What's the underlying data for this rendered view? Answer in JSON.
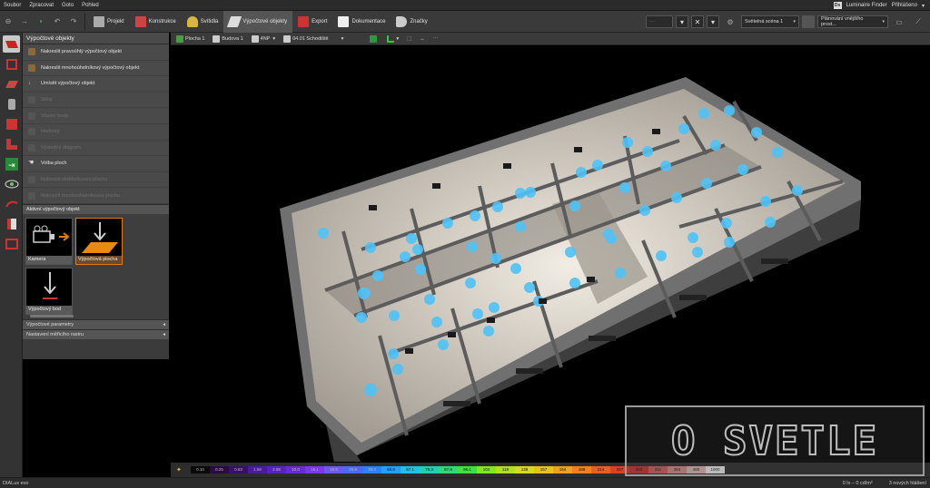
{
  "menu": {
    "items": [
      "Soubor",
      "Zpracovat",
      "Goto",
      "Pohled"
    ],
    "luminaire_finder": "Luminaire Finder",
    "login": "Přihlášeno"
  },
  "toolbar": {
    "tabs": [
      {
        "label": "Projekt",
        "color": "#b0b0b0"
      },
      {
        "label": "Konstrukce",
        "color": "#d9534f"
      },
      {
        "label": "Svítidla",
        "color": "#e8c14a"
      },
      {
        "label": "Výpočtové objekty",
        "color": "#cccccc",
        "active": true
      },
      {
        "label": "Export",
        "color": "#cc3333"
      },
      {
        "label": "Dokumentace",
        "color": "#ffffff"
      },
      {
        "label": "Značky",
        "color": "#dddddd"
      }
    ],
    "scene_select": "Světelná scéna 1",
    "plan_select": "Plánování vnějšího prost..."
  },
  "left_panel": {
    "title": "Výpočtové objekty",
    "items": [
      {
        "label": "Nakreslit pravoúhlý výpočtový objekt",
        "enabled": true
      },
      {
        "label": "Nakreslit mnohoúhelníkový výpočtový objekt",
        "enabled": true
      },
      {
        "label": "Umístit výpočtový objekt",
        "enabled": true
      },
      {
        "label": "Stíny",
        "enabled": false
      },
      {
        "label": "Vlastní body",
        "enabled": false
      },
      {
        "label": "Hodnoty",
        "enabled": false
      },
      {
        "label": "Výsledný diagram",
        "enabled": false
      },
      {
        "label": "Volba ploch",
        "enabled": true
      },
      {
        "label": "Nakreslit obdélníkovou plochu",
        "enabled": false
      },
      {
        "label": "Nakreslit mnohoúhelníkovou plochu",
        "enabled": false
      }
    ],
    "active_section": "Aktivní výpočtový objekt",
    "tiles": [
      {
        "label": "Kamera",
        "selected": false
      },
      {
        "label": "Výpočtová plocha",
        "selected": true
      },
      {
        "label": "Výpočtový bod",
        "selected": false
      }
    ],
    "collapsed": [
      "Výpočtové parametry",
      "Nastavení měřicího rastru"
    ]
  },
  "view_toolbar": {
    "chips": [
      "Plocha 1",
      "Budova 1",
      "4NP",
      "04.01 Schodiště"
    ]
  },
  "scale": {
    "values": [
      "0.10",
      "0.25",
      "0.63",
      "1.58",
      "2.98",
      "10.0",
      "15.1",
      "18.5",
      "25.9",
      "39.4",
      "50.8",
      "57.1",
      "76.3",
      "87.8",
      "96.1",
      "104",
      "119",
      "138",
      "157",
      "164",
      "188",
      "214",
      "257",
      "283",
      "311",
      "384",
      "480",
      "1000"
    ],
    "colors": [
      "#0a0a0a",
      "#2a0a40",
      "#3a0f6b",
      "#4a1aa0",
      "#5a22c0",
      "#6a2ad8",
      "#7a38e8",
      "#6a5af0",
      "#4a6af5",
      "#2a80ff",
      "#20a0ff",
      "#20c0e8",
      "#20d0b0",
      "#30d878",
      "#40e040",
      "#80e820",
      "#b0e020",
      "#d8d820",
      "#e8c020",
      "#f0a020",
      "#f08020",
      "#e86020",
      "#e04020",
      "#d83030",
      "#e06060",
      "#e89090",
      "#f0c0c0",
      "#ffffff"
    ]
  },
  "status": {
    "app": "DIALux evo",
    "lux": "0 lx – 0 cd/m²",
    "messages": "3 nových hlášení"
  },
  "watermark": "O SVETLE"
}
